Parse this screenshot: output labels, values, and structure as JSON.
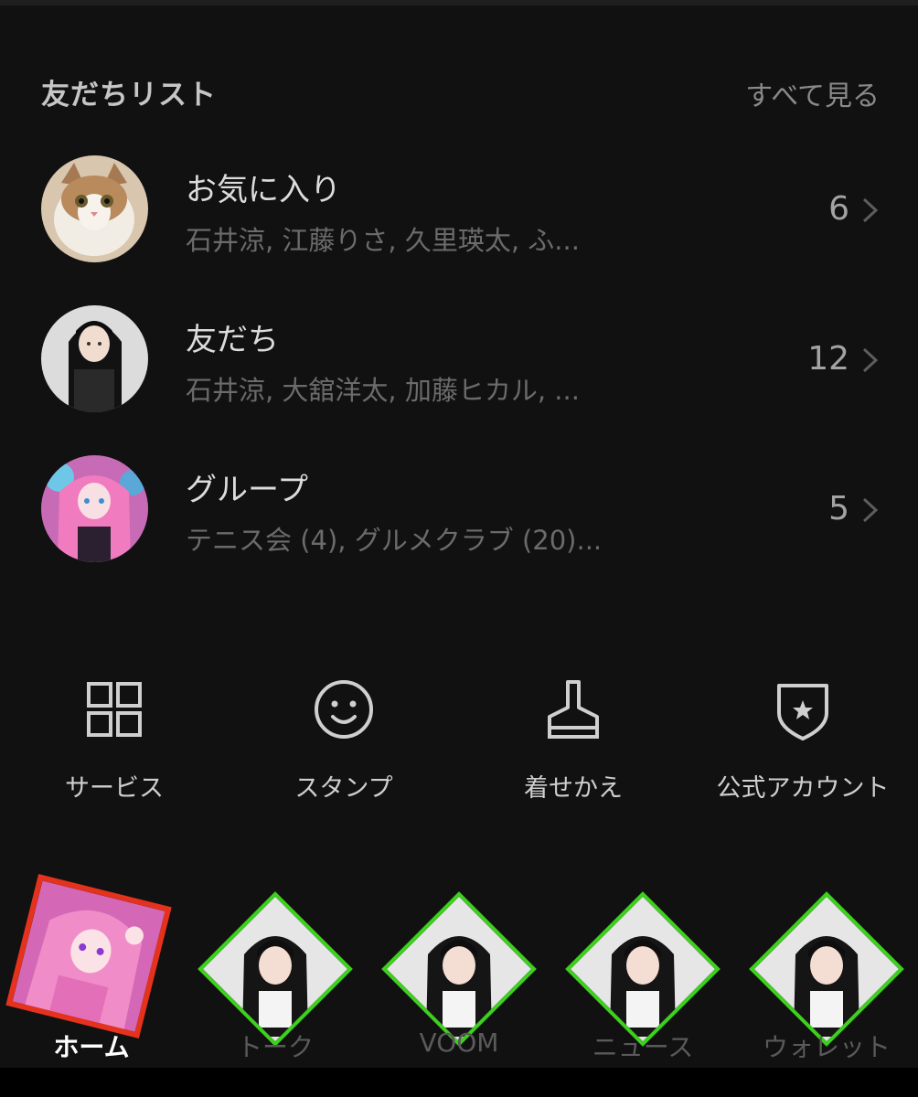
{
  "header": {
    "title": "友だちリスト",
    "see_all": "すべて見る"
  },
  "friend_groups": [
    {
      "title": "お気に入り",
      "members": "石井涼, 江藤りさ, 久里瑛太, ふ...",
      "count": "6",
      "avatar": "cat-photo"
    },
    {
      "title": "友だち",
      "members": "石井涼, 大舘洋太, 加藤ヒカル, ...",
      "count": "12",
      "avatar": "dark-haired-girl"
    },
    {
      "title": "グループ",
      "members": "テニス会 (4), グルメクラブ (20)...",
      "count": "5",
      "avatar": "pink-haired-girl"
    }
  ],
  "services": [
    {
      "label": "サービス",
      "icon": "grid-icon"
    },
    {
      "label": "スタンプ",
      "icon": "smiley-icon"
    },
    {
      "label": "着せかえ",
      "icon": "brush-icon"
    },
    {
      "label": "公式アカウント",
      "icon": "shield-star-icon"
    }
  ],
  "nav": [
    {
      "label": "ホーム",
      "active": true
    },
    {
      "label": "トーク",
      "active": false
    },
    {
      "label": "VOOM",
      "active": false
    },
    {
      "label": "ニュース",
      "active": false
    },
    {
      "label": "ウォレット",
      "active": false
    }
  ],
  "colors": {
    "background": "#111111",
    "home_border": "#e5321c",
    "nav_border": "#3cd11c"
  }
}
